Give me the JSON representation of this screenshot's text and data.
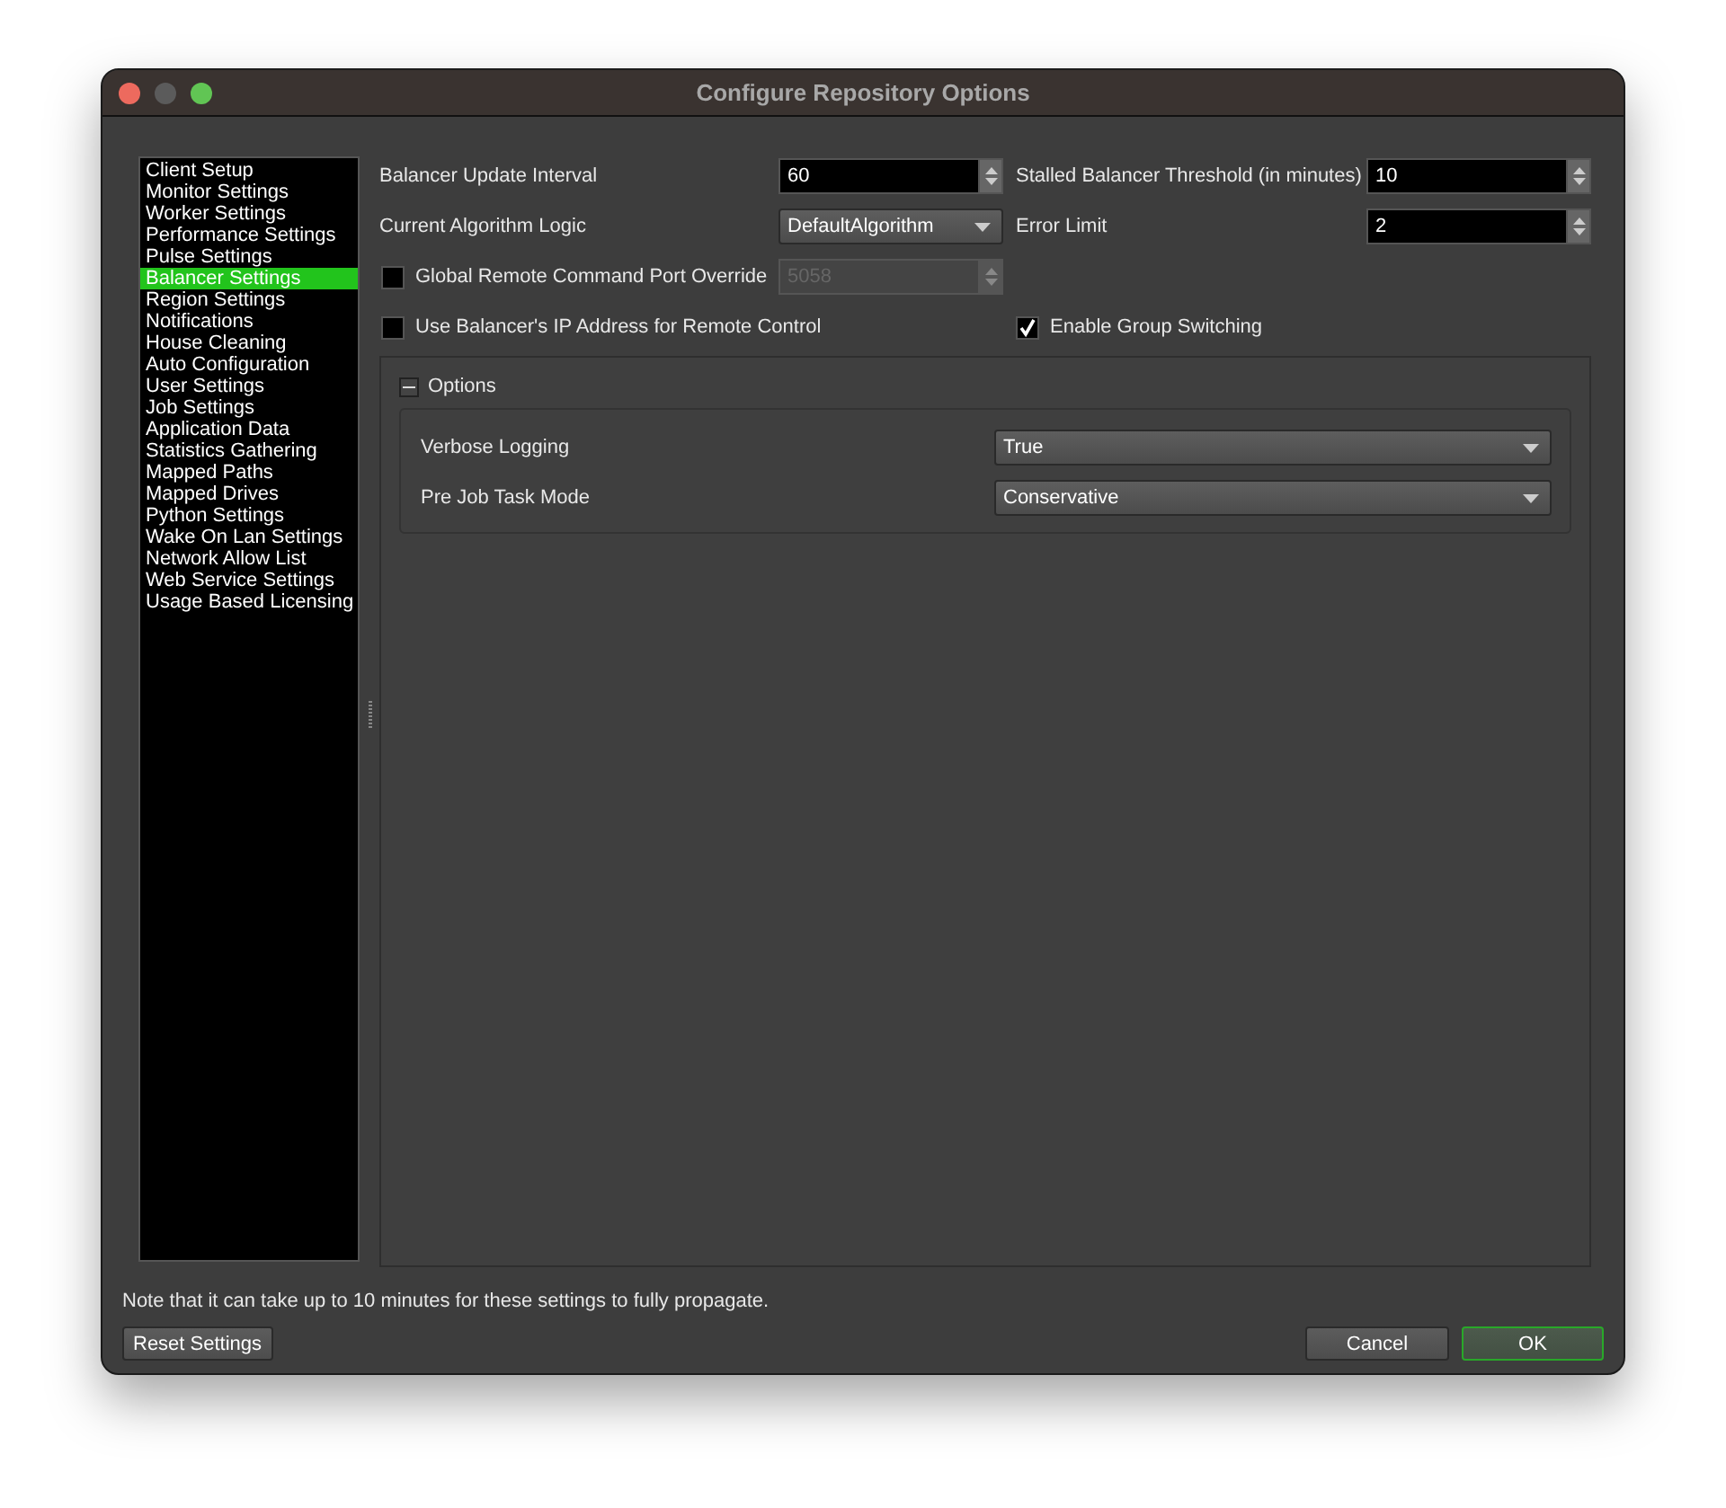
{
  "window": {
    "title": "Configure Repository Options"
  },
  "sidebar": {
    "items": [
      {
        "label": "Client Setup",
        "selected": false
      },
      {
        "label": "Monitor Settings",
        "selected": false
      },
      {
        "label": "Worker Settings",
        "selected": false
      },
      {
        "label": "Performance Settings",
        "selected": false
      },
      {
        "label": "Pulse Settings",
        "selected": false
      },
      {
        "label": "Balancer Settings",
        "selected": true
      },
      {
        "label": "Region Settings",
        "selected": false
      },
      {
        "label": "Notifications",
        "selected": false
      },
      {
        "label": "House Cleaning",
        "selected": false
      },
      {
        "label": "Auto Configuration",
        "selected": false
      },
      {
        "label": "User Settings",
        "selected": false
      },
      {
        "label": "Job Settings",
        "selected": false
      },
      {
        "label": "Application Data",
        "selected": false
      },
      {
        "label": "Statistics Gathering",
        "selected": false
      },
      {
        "label": "Mapped Paths",
        "selected": false
      },
      {
        "label": "Mapped Drives",
        "selected": false
      },
      {
        "label": "Python Settings",
        "selected": false
      },
      {
        "label": "Wake On Lan Settings",
        "selected": false
      },
      {
        "label": "Network Allow List",
        "selected": false
      },
      {
        "label": "Web Service Settings",
        "selected": false
      },
      {
        "label": "Usage Based Licensing",
        "selected": false
      }
    ]
  },
  "settings": {
    "rows": [
      {
        "left": {
          "kind": "spin",
          "label": "Balancer Update Interval",
          "value": "60",
          "disabled": false
        },
        "right": {
          "kind": "spin",
          "label": "Stalled Balancer Threshold (in minutes)",
          "value": "10",
          "disabled": false
        }
      },
      {
        "left": {
          "kind": "combo",
          "label": "Current Algorithm Logic",
          "value": "DefaultAlgorithm"
        },
        "right": {
          "kind": "spin",
          "label": "Error Limit",
          "value": "2",
          "disabled": false
        }
      },
      {
        "left": {
          "kind": "check-spin",
          "label": "Global Remote Command Port Override",
          "checked": false,
          "value": "5058",
          "disabled": true
        }
      },
      {
        "left": {
          "kind": "check",
          "label": "Use Balancer's IP Address for Remote Control",
          "checked": false
        },
        "right": {
          "kind": "check",
          "label": "Enable Group Switching",
          "checked": true
        }
      }
    ]
  },
  "options": {
    "title": "Options",
    "expanded": true,
    "rows": [
      {
        "label": "Verbose Logging",
        "value": "True"
      },
      {
        "label": "Pre Job Task Mode",
        "value": "Conservative"
      }
    ]
  },
  "note": "Note that it can take up to 10 minutes for these settings to fully propagate.",
  "buttons": [
    {
      "label": "Reset Settings",
      "kind": "left",
      "default": false
    },
    {
      "label": "Cancel",
      "kind": "right",
      "default": false
    },
    {
      "label": "OK",
      "kind": "right",
      "default": true
    }
  ]
}
